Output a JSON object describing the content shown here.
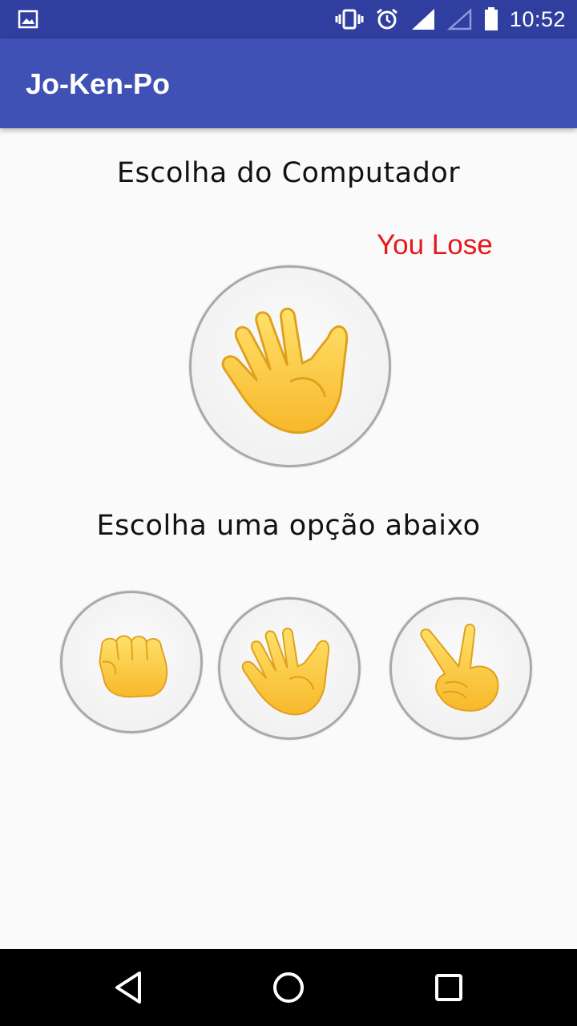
{
  "status_bar": {
    "time": "10:52",
    "icons": [
      "gallery-icon",
      "vibrate-icon",
      "alarm-icon",
      "signal-icon",
      "signal-empty-icon",
      "battery-icon"
    ]
  },
  "app_bar": {
    "title": "Jo-Ken-Po"
  },
  "computer": {
    "heading": "Escolha do Computador",
    "result": "You Lose",
    "choice_icon": "open-hand-icon",
    "colors": {
      "result": "#e8161a"
    }
  },
  "player": {
    "heading": "Escolha uma opção abaixo",
    "options": [
      {
        "icon": "fist-icon",
        "meaning": "rock"
      },
      {
        "icon": "open-hand-icon",
        "meaning": "paper"
      },
      {
        "icon": "victory-hand-icon",
        "meaning": "scissors"
      }
    ]
  },
  "nav_bar": {
    "icons": [
      "back-icon",
      "home-icon",
      "recents-icon"
    ]
  },
  "colors": {
    "status_bar": "#303f9f",
    "app_bar": "#3f51b5",
    "background": "#fafafa",
    "emoji": "#ffcc3d"
  }
}
